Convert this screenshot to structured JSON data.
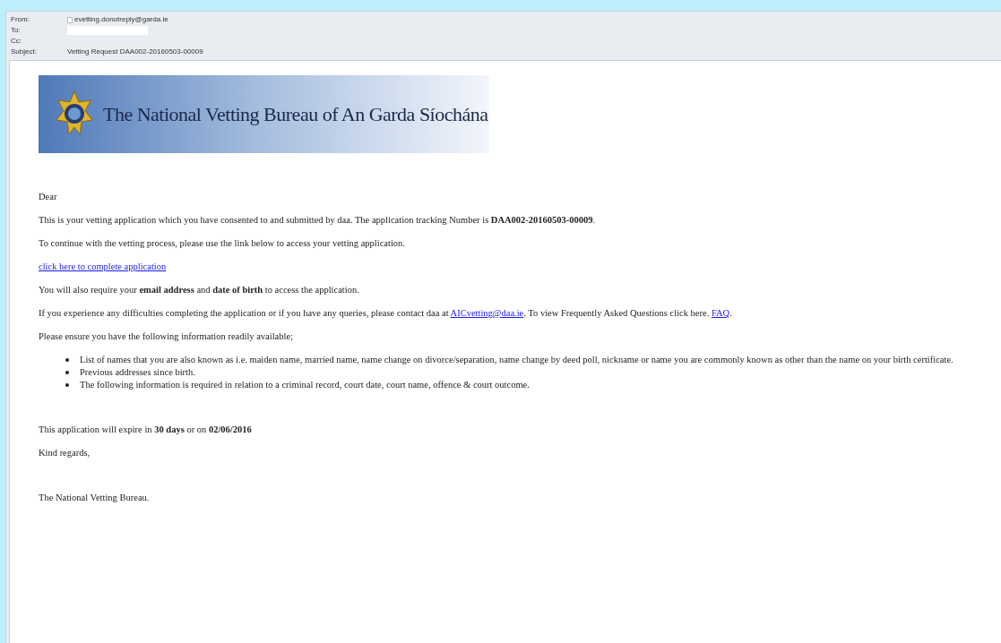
{
  "header": [
    {
      "label": "From:",
      "value": "evetting.donotreply@garda.ie",
      "kind": "sender"
    },
    {
      "label": "To:",
      "kind": "redacted"
    },
    {
      "label": "Cc:",
      "kind": "empty"
    },
    {
      "label": "Subject:",
      "value": "Vetting Request DAA002-20160503-00009",
      "kind": "text"
    }
  ],
  "banner": {
    "title": "The National Vetting Bureau of An Garda Síochána"
  },
  "body": [
    {
      "kind": "para",
      "segments": [
        {
          "kind": "text",
          "text": "Dear"
        }
      ]
    },
    {
      "kind": "para",
      "segments": [
        {
          "kind": "text",
          "text": "This is your vetting application which you have consented to and submitted by daa. The application tracking Number is **DAA002-20160503-00009**."
        }
      ]
    },
    {
      "kind": "para",
      "segments": [
        {
          "kind": "text",
          "text": "To continue with the vetting process, please use the link below to access your vetting application."
        }
      ]
    },
    {
      "kind": "para",
      "segments": [
        {
          "kind": "link",
          "text": "click here to complete application"
        }
      ]
    },
    {
      "kind": "para",
      "segments": [
        {
          "kind": "text",
          "text": "You will also require your **email address** and **date of birth** to access the application."
        }
      ]
    },
    {
      "kind": "para",
      "segments": [
        {
          "kind": "text",
          "text": "If you experience any difficulties completing the application or if you have any queries, please contact daa at "
        },
        {
          "kind": "link",
          "text": "AICvetting@daa.ie"
        },
        {
          "kind": "text",
          "text": ". To view Frequently Asked Questions click here. "
        },
        {
          "kind": "link",
          "text": "FAQ"
        },
        {
          "kind": "text",
          "text": "."
        }
      ]
    },
    {
      "kind": "para",
      "segments": [
        {
          "kind": "text",
          "text": "Please ensure you have the following information readily available;"
        }
      ]
    },
    {
      "kind": "list",
      "items": [
        "List of names that you are also known as i.e. maiden name, married name, name change on divorce/separation, name change by deed poll, nickname or name you are commonly known as other than the name on your birth certificate.",
        "Previous addresses since birth.",
        "The following information is required in relation to a criminal record, court date, court name, offence & court outcome."
      ]
    },
    {
      "kind": "gap"
    },
    {
      "kind": "para",
      "segments": [
        {
          "kind": "text",
          "text": "This application will expire in **30 days** or on **02/06/2016**"
        }
      ]
    },
    {
      "kind": "para",
      "segments": [
        {
          "kind": "text",
          "text": "Kind regards,"
        }
      ]
    },
    {
      "kind": "gap"
    },
    {
      "kind": "para",
      "segments": [
        {
          "kind": "text",
          "text": "The National Vetting Bureau."
        }
      ]
    }
  ]
}
